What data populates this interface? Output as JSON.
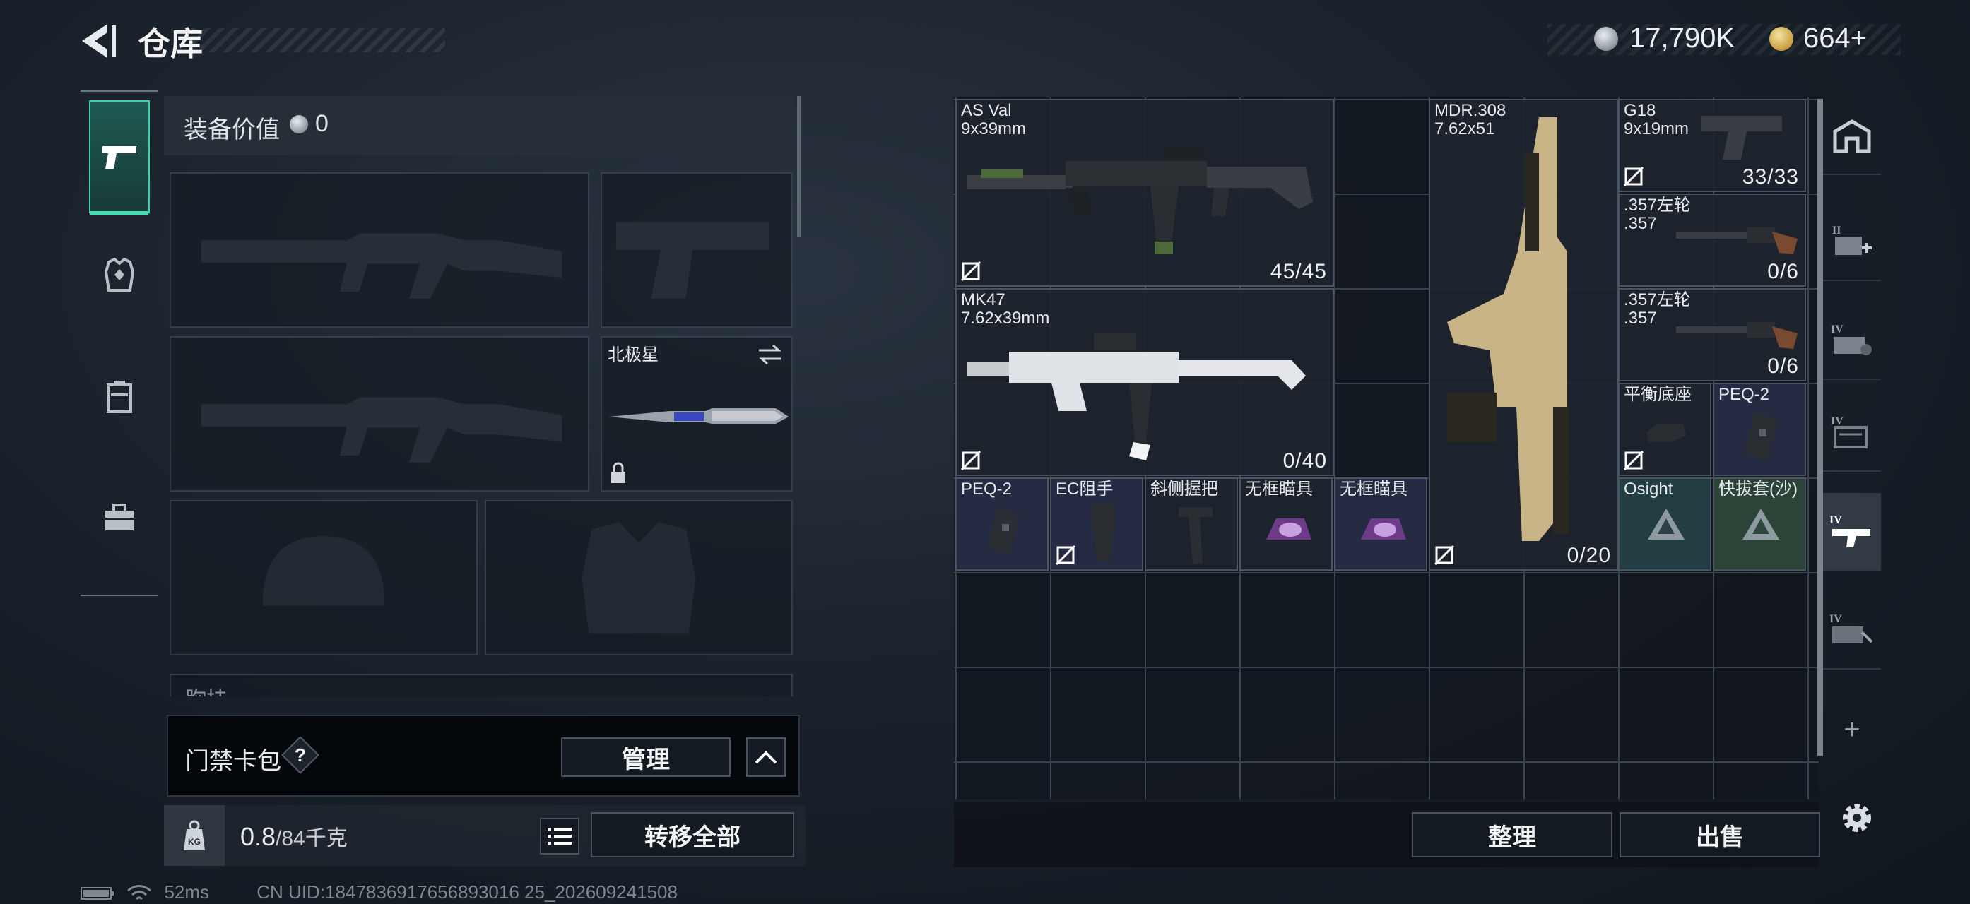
{
  "header": {
    "title": "仓库",
    "currency_silver": "17,790K",
    "currency_gold": "664+"
  },
  "equipment": {
    "value_label": "装备价值",
    "value": "0",
    "melee_name": "北极星",
    "chest_label": "胸挂"
  },
  "keycard": {
    "label": "门禁卡包",
    "help": "?",
    "manage_label": "管理"
  },
  "capacity": {
    "current": "0.8",
    "max_text": "/84千克",
    "transfer_label": "转移全部"
  },
  "status": {
    "ping": "52ms",
    "uid": "CN UID:1847836917656893016 25_202609241508"
  },
  "storage": {
    "items": [
      {
        "id": "asval",
        "name": "AS Val\n9x39mm",
        "ammo": "45/45",
        "locked": true,
        "color": "#000000"
      },
      {
        "id": "mk47",
        "name": "MK47\n7.62x39mm",
        "ammo": "0/40",
        "locked": true
      },
      {
        "id": "mdr",
        "name": "MDR.308\n7.62x51",
        "ammo": "0/20",
        "locked": true
      },
      {
        "id": "g18",
        "name": "G18\n9x19mm",
        "ammo": "33/33",
        "locked": true
      },
      {
        "id": "rev1",
        "name": ".357左轮\n.357",
        "ammo": "0/6",
        "locked": false
      },
      {
        "id": "rev2",
        "name": ".357左轮\n.357",
        "ammo": "0/6",
        "locked": false
      },
      {
        "id": "mount",
        "name": "平衡底座",
        "locked": true
      },
      {
        "id": "peq2a",
        "name": "PEQ-2"
      },
      {
        "id": "peq2b",
        "name": "PEQ-2"
      },
      {
        "id": "ec",
        "name": "EC阻手",
        "locked": true
      },
      {
        "id": "grip",
        "name": "斜侧握把"
      },
      {
        "id": "sight1",
        "name": "无框瞄具"
      },
      {
        "id": "sight2",
        "name": "无框瞄具"
      },
      {
        "id": "osight",
        "name": "Osight"
      },
      {
        "id": "holster",
        "name": "快拔套(沙)"
      }
    ],
    "arrange_label": "整理",
    "sell_label": "出售",
    "add_label": "+"
  },
  "colors": {
    "accent": "#3fd0a8",
    "gold": "#c79f3e",
    "silver": "#8d969c"
  }
}
